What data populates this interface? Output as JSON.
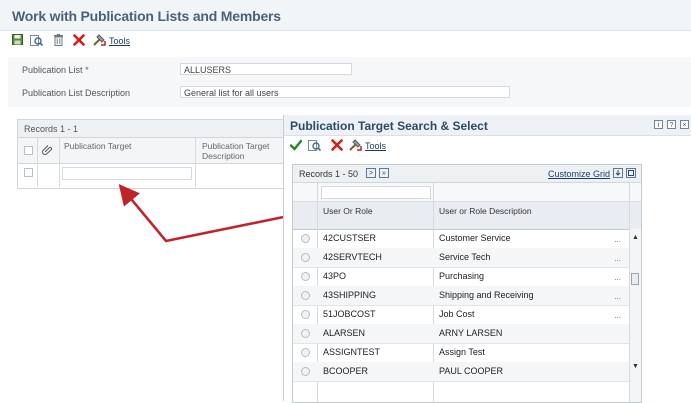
{
  "window": {
    "title": "Work with Publication Lists and Members"
  },
  "toolbar": {
    "tools_label": "Tools"
  },
  "form": {
    "list_label": "Publication List",
    "required_marker": "*",
    "list_value": "ALLUSERS",
    "desc_label": "Publication List Description",
    "desc_value": "General list for all users"
  },
  "members_grid": {
    "records": "Records 1 - 1",
    "col_target": "Publication Target",
    "col_desc": "Publication Target Description"
  },
  "popup": {
    "title": "Publication Target Search & Select",
    "tools_label": "Tools",
    "records": "Records 1 - 50",
    "customize": "Customize Grid",
    "col_user": "User Or Role",
    "col_desc": "User or Role Description",
    "rows": [
      {
        "user": "42CUSTSER",
        "desc": "Customer Service",
        "more": "..."
      },
      {
        "user": "42SERVTECH",
        "desc": "Service Tech",
        "more": "..."
      },
      {
        "user": "43PO",
        "desc": "Purchasing",
        "more": "..."
      },
      {
        "user": "43SHIPPING",
        "desc": "Shipping and Receiving",
        "more": "..."
      },
      {
        "user": "51JOBCOST",
        "desc": "Job Cost",
        "more": "..."
      },
      {
        "user": "ALARSEN",
        "desc": "ARNY LARSEN",
        "more": ""
      },
      {
        "user": "ASSIGNTEST",
        "desc": "Assign Test",
        "more": ""
      },
      {
        "user": "BCOOPER",
        "desc": "PAUL COOPER",
        "more": ""
      }
    ]
  },
  "colors": {
    "title": "#4a6278",
    "popup_title": "#2b4a66",
    "arrow": "#c0242b",
    "check": "#1f8a1f",
    "delete": "#d01e1e"
  }
}
